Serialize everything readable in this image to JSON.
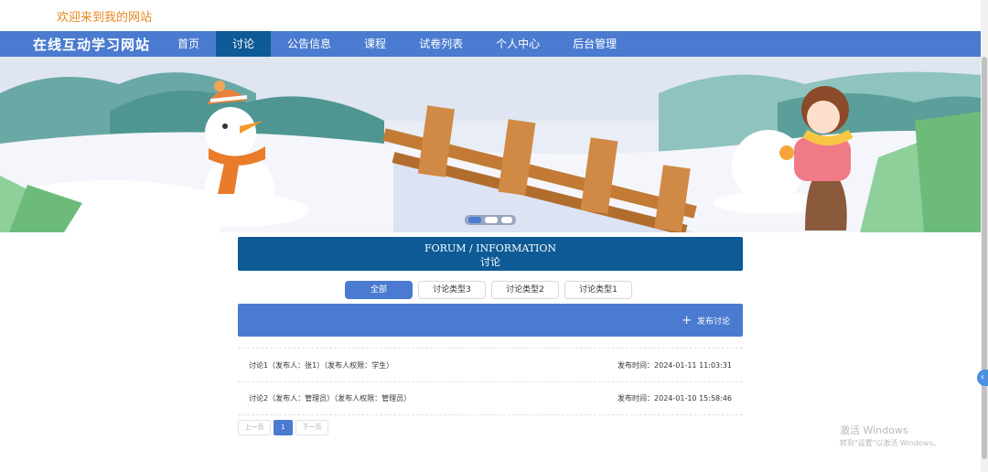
{
  "header": {
    "welcome": "欢迎来到我的网站"
  },
  "navbar": {
    "site_title": "在线互动学习网站",
    "items": [
      {
        "label": "首页"
      },
      {
        "label": "讨论"
      },
      {
        "label": "公告信息"
      },
      {
        "label": "课程"
      },
      {
        "label": "试卷列表"
      },
      {
        "label": "个人中心"
      },
      {
        "label": "后台管理"
      }
    ],
    "active_index": 1
  },
  "forum": {
    "title_en": "FORUM / INFORMATION",
    "title_cn": "讨论"
  },
  "tabs": [
    {
      "label": "全部"
    },
    {
      "label": "讨论类型3"
    },
    {
      "label": "讨论类型2"
    },
    {
      "label": "讨论类型1"
    }
  ],
  "action": {
    "post_label": "发布讨论",
    "plus_glyph": "+"
  },
  "list": [
    {
      "title": "讨论1（发布人：张1）（发布人权限：学生）",
      "time": "发布时间：2024-01-11 11:03:31"
    },
    {
      "title": "讨论2（发布人：管理员）（发布人权限：管理员）",
      "time": "发布时间：2024-01-10 15:58:46"
    }
  ],
  "pagination": {
    "prev": "上一页",
    "current": "1",
    "next": "下一页"
  },
  "watermark": {
    "line1": "激活 Windows",
    "line2": "转到\"设置\"以激活 Windows。"
  },
  "colors": {
    "nav": "#4a7bd0",
    "nav_active": "#0d5a96",
    "welcome": "#e6891e"
  }
}
